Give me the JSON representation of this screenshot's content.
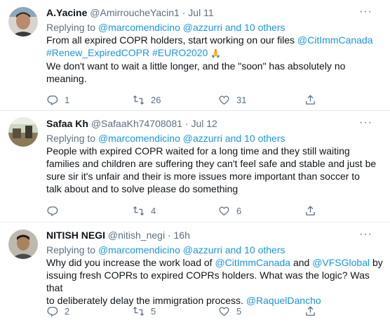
{
  "tweets": [
    {
      "name": "A.Yacine",
      "handle": "@AmirroucheYacin1",
      "sep": "·",
      "date": "Jul 11",
      "more": "···",
      "replying_prefix": "Replying to",
      "replying_user1": "@marcomendicino",
      "replying_user2": "@azzurri",
      "replying_and": "and",
      "replying_others": "10 others",
      "text_lines": [
        "From all expired COPR holders, start working on our files",
        "We don't want to wait a little longer, and the \"soon\" has absolutely no",
        "meaning."
      ],
      "mention_cit": "@CitImmCanada",
      "hashtag1": "#Renew_ExpiredCOPR",
      "hashtag2": "#EURO2020",
      "emoji": "🙏",
      "replies": "1",
      "retweets": "26",
      "likes": "31"
    },
    {
      "name": "Safaa Kh",
      "handle": "@SafaaKh74708081",
      "sep": "·",
      "date": "Jul 12",
      "more": "···",
      "replying_prefix": "Replying to",
      "replying_user1": "@marcomendicino",
      "replying_user2": "@azzurri",
      "replying_and": "and",
      "replying_others": "10 others",
      "text_lines": [
        "People with expired COPR waited for a long time and they still waiting",
        "families and children are suffering they can't feel safe and stable and just be",
        "sure sir it's unfair and their is more issues more important than soccer to",
        "talk about and to solve please do something"
      ],
      "replies": "",
      "retweets": "4",
      "likes": "6"
    },
    {
      "name": "NITISH NEGI",
      "handle": "@nitish_negi",
      "sep": "·",
      "date": "16h",
      "more": "···",
      "replying_prefix": "Replying to",
      "replying_user1": "@marcomendicino",
      "replying_user2": "@azzurri",
      "replying_and": "and",
      "replying_others": "10 others",
      "text_parts": {
        "l1a": "Why did you increase the work load of",
        "l1_mention1": "@CitImmCanada",
        "l1b": "and",
        "l1_mention2": "@VFSGlobal",
        "l1c": "by",
        "l2": "issuing fresh COPRs to expired COPRs holders. What was the logic? Was that",
        "l3a": "to deliberately delay the immigration process.",
        "l3_mention": "@RaquelDancho"
      },
      "replies": "2",
      "retweets": "5",
      "likes": "5"
    }
  ],
  "colors": {
    "link": "#1b95e0",
    "muted": "#5b7083",
    "text": "#0f1419",
    "divider": "#e6ecf0"
  },
  "icons": [
    "reply-icon",
    "retweet-icon",
    "like-icon",
    "share-icon",
    "more-icon"
  ]
}
